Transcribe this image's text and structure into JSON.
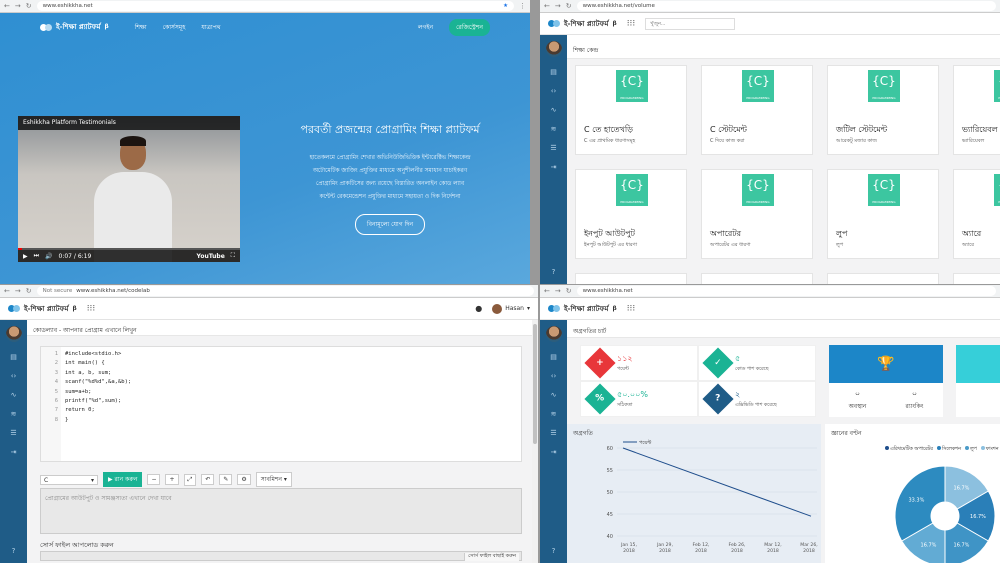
{
  "q1": {
    "url": "www.eshikkha.net",
    "brand": "ই-শিক্ষা প্ল্যাটফর্ম",
    "beta": "β",
    "nav": [
      "শিক্ষা",
      "কোর্সসমূহ",
      "যাত্রাপথ"
    ],
    "login": "লগইন",
    "register": "রেজিস্ট্রেশন",
    "video": {
      "title": "Eshikkha Platform Testimonials",
      "time": "0:07 / 6:19",
      "yt": "YouTube"
    },
    "hero_title": "পরবর্তী প্রজন্মের প্রোগ্রামিং শিক্ষা প্ল্যাটফর্ম",
    "hero_lines": [
      "হাতেকলমে প্রোগ্রামিং শেখার অভিনিউজিভিত্তিক ইন্টারেক্টিভ শিক্ষাকেন্দ্র",
      "অটোমেটিক জাজিং প্রযুক্তির মাধ্যমে অনুশীলনীর সমাধান যাচাইকরণ",
      "প্রোগ্রামিং প্রাকটিসের জন্য রয়েছে বিস্তারিত অনলাইন কোড ল্যাব",
      "কন্টেন্ট রেকমেন্ডেশন প্রযুক্তির মাধ্যমে সহায়তা ও দিক নির্দেশনা"
    ],
    "cta": "বিনামূল্যে যোগ দিন"
  },
  "q2": {
    "url": "www.eshikkha.net/volume",
    "brand": "ই-শিক্ষা প্ল্যাটফর্ম",
    "beta": "β",
    "search_ph": "খুঁজুন...",
    "crumb": "শিক্ষা কেন্দ্র",
    "badge": "PROGRAMMING",
    "cards": [
      {
        "title": "C তে হাতেখড়ি",
        "sub": "C এর প্রাথমিক ধারণাসমূহ"
      },
      {
        "title": "C স্টেটমেন্ট",
        "sub": "C দিয়ে কাজ করা"
      },
      {
        "title": "জটিল স্টেটমেন্ট",
        "sub": "আরেকটু মজার কাজ"
      },
      {
        "title": "ভ্যারিয়েবল",
        "sub": "ভ্যারিয়েবল"
      },
      {
        "title": "ইনপুট আউটপুট",
        "sub": "ইনপুট আউটপুট এর ধারণা"
      },
      {
        "title": "অপারেটর",
        "sub": "অপারেটর এর ধারণা"
      },
      {
        "title": "লুপ",
        "sub": "লুপ"
      },
      {
        "title": "অ্যারে",
        "sub": "অ্যারে"
      }
    ]
  },
  "q3": {
    "url": "www.eshikkha.net/codelab",
    "secure": "Not secure",
    "brand": "ই-শিক্ষা প্ল্যাটফর্ম",
    "beta": "β",
    "user": "Hasan",
    "crumb": "কোডল্যাব - আপনার প্রোগ্রাম এখানে লিখুন",
    "code": [
      "#include<stdio.h>",
      "int main() {",
      "int a, b, sum;",
      "scanf(\"%d%d\",&a,&b);",
      "sum=a+b;",
      "printf(\"%d\",sum);",
      "return 0;",
      "}"
    ],
    "lang": "C",
    "run": "রান করুন",
    "submit": "সাবমিশন",
    "output_ph": "প্রোগ্রামের আউটপুট ও সামঞ্জস্যতা এখানে দেখা যাবে",
    "upload": "সোর্স ফাইল আপলোড করুন",
    "choose": "সোর্স ফাইল বাছাই করুন"
  },
  "q4": {
    "url": "www.eshikkha.net",
    "brand": "ই-শিক্ষা প্ল্যাটফর্ম",
    "beta": "β",
    "crumb": "অগ্রগতির চার্ট",
    "stats": [
      {
        "num": "১১২",
        "label": "পয়েন্ট",
        "color": "#e8363a",
        "icon": "+"
      },
      {
        "num": "৫",
        "label": "কোড পাশ করেছে",
        "color": "#1ab394",
        "icon": "✓"
      },
      {
        "num": "৫০.০০%",
        "label": "সঠিকতা",
        "color": "#1ab394",
        "icon": "%"
      },
      {
        "num": "২",
        "label": "এক্সিভিডি পাশ করেছে",
        "color": "#1f5c87",
        "icon": "?"
      }
    ],
    "trophy": {
      "color": "#1c86c8",
      "vals": [
        {
          "n": "০",
          "l": "অবস্থান"
        },
        {
          "n": "০",
          "l": "র‍্যাংকিং"
        }
      ]
    },
    "cyan_color": "#36cfd9",
    "progress_title": "অগ্রগতি",
    "knowledge_title": "জ্ঞানের বণ্টন",
    "legend": [
      "এরিথমেটিক অপারেটর",
      "সিলেকশন",
      "লুপ",
      "ফাংশন"
    ],
    "pie_labels": [
      "16.7%",
      "16.7%",
      "16.7%",
      "16.7%",
      "33.3%",
      "16.7%"
    ]
  },
  "chart_data": {
    "type": "line",
    "series": [
      {
        "name": "পয়েন্ট",
        "values": [
          60,
          55,
          50,
          45
        ]
      }
    ],
    "x": [
      "Jan 15, 2018",
      "Mar 28, 2018"
    ],
    "categories": [
      "Jan 15, 2018",
      "Jan 29, 2018",
      "Feb 12, 2018",
      "Feb 26, 2018",
      "Mar 12, 2018",
      "Mar 26, 2018"
    ],
    "ylim": [
      40,
      60
    ],
    "yticks": [
      60,
      55,
      50,
      45,
      40
    ],
    "line": {
      "x0": "Jan 15, 2018",
      "y0": 60,
      "x1": "Mar 28, 2018",
      "y1": 44.5
    }
  }
}
